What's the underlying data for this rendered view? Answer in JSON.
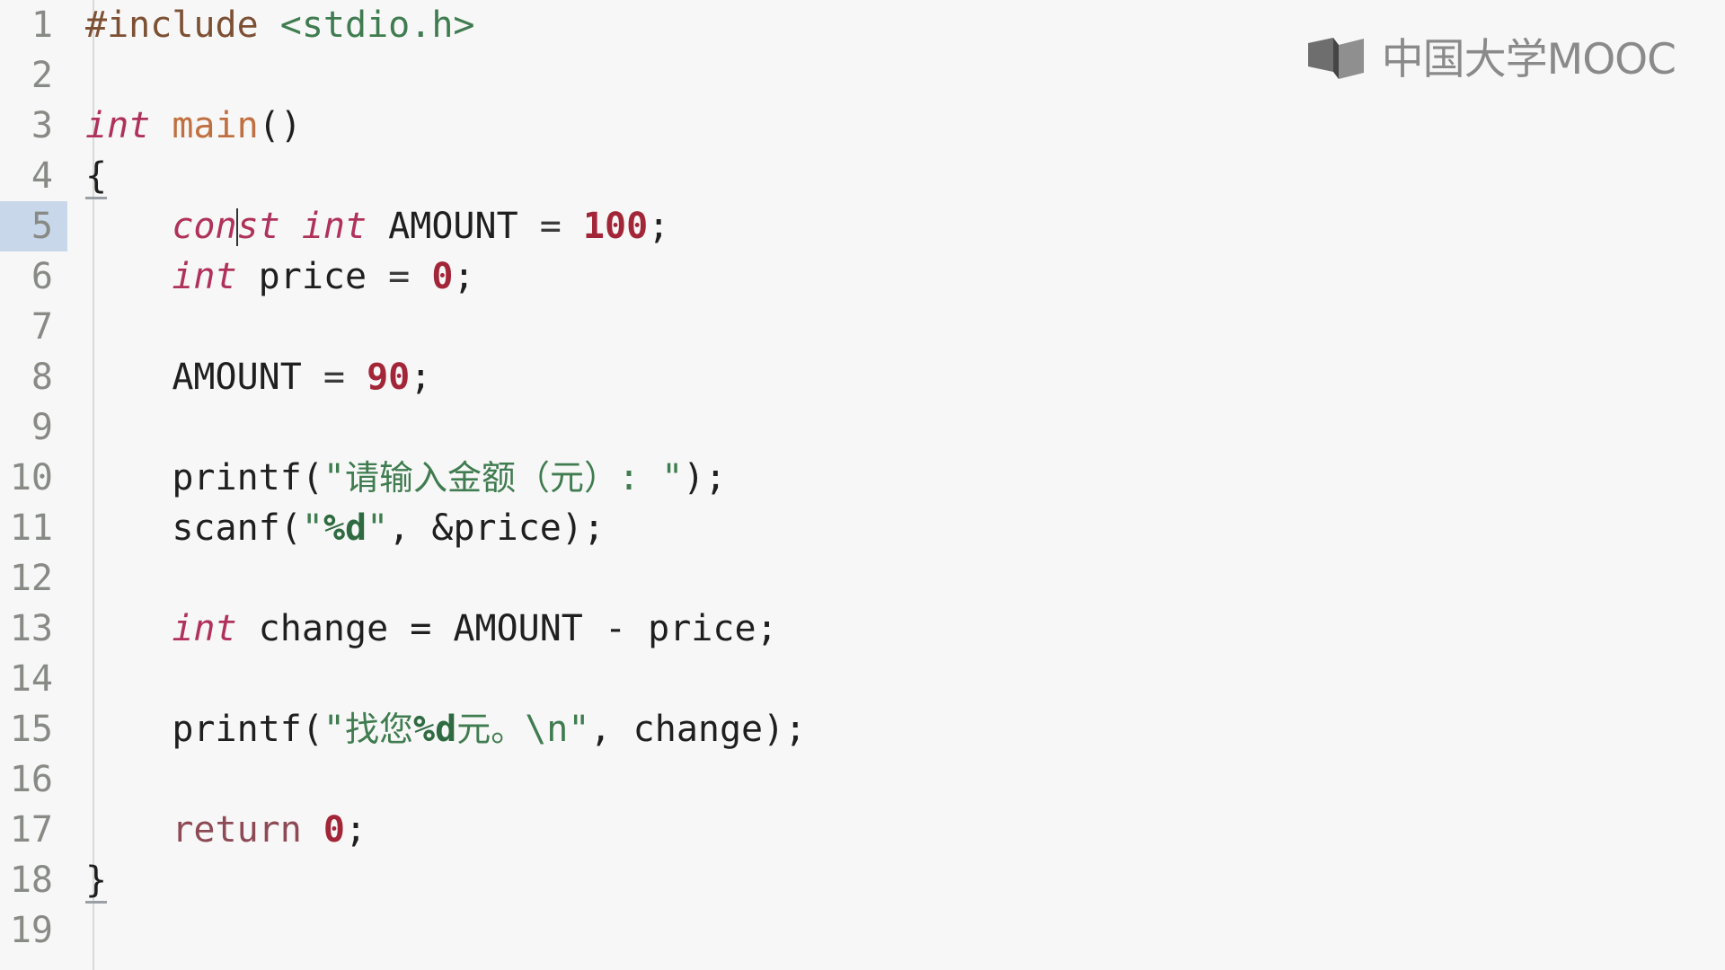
{
  "editor": {
    "language": "c",
    "active_line": 5,
    "cursor": {
      "line": 5,
      "column": 8
    },
    "gutter_first": "1",
    "gutter_last": "19",
    "colors": {
      "background": "#f7f7f7",
      "gutter_text": "#888a85",
      "active_line_gutter": "#c8d8ea",
      "keyword": "#b0315a",
      "string": "#3f7c4f",
      "number": "#a32638",
      "preprocessor": "#7d5033",
      "function": "#c07040",
      "plain": "#1f1f1f"
    },
    "lines": [
      {
        "n": "1",
        "text": "#include <stdio.h>"
      },
      {
        "n": "2",
        "text": ""
      },
      {
        "n": "3",
        "text": "int main()"
      },
      {
        "n": "4",
        "text": "{"
      },
      {
        "n": "5",
        "text": "    const int AMOUNT = 100;"
      },
      {
        "n": "6",
        "text": "    int price = 0;"
      },
      {
        "n": "7",
        "text": ""
      },
      {
        "n": "8",
        "text": "    AMOUNT = 90;"
      },
      {
        "n": "9",
        "text": ""
      },
      {
        "n": "10",
        "text": "    printf(\"请输入金额（元）: \");"
      },
      {
        "n": "11",
        "text": "    scanf(\"%d\", &price);"
      },
      {
        "n": "12",
        "text": ""
      },
      {
        "n": "13",
        "text": "    int change = AMOUNT - price;"
      },
      {
        "n": "14",
        "text": ""
      },
      {
        "n": "15",
        "text": "    printf(\"找您%d元。\\n\", change);"
      },
      {
        "n": "16",
        "text": ""
      },
      {
        "n": "17",
        "text": "    return 0;"
      },
      {
        "n": "18",
        "text": "}"
      },
      {
        "n": "19",
        "text": ""
      }
    ],
    "tokens": {
      "l1_include": "#include",
      "l1_header": "<stdio.h>",
      "l3_int": "int",
      "l3_main": "main",
      "l3_parens": "()",
      "l4_brace": "{",
      "l5_indent": "    ",
      "l5_con": "con",
      "l5_st": "st",
      "l5_space1": " ",
      "l5_int": "int",
      "l5_amount": " AMOUNT ",
      "l5_eq": "=",
      "l5_num": " 100",
      "l5_semi": ";",
      "l6_int": "int",
      "l6_price": " price ",
      "l6_eq": "=",
      "l6_num": " 0",
      "l6_semi": ";",
      "l8_amount": "AMOUNT ",
      "l8_eq": "=",
      "l8_num": " 90",
      "l8_semi": ";",
      "l10_printf": "printf",
      "l10_open": "(",
      "l10_quote1": "\"",
      "l10_cjk": "请输入金额（元）",
      "l10_colon": ": ",
      "l10_quote2": "\"",
      "l10_close": ");",
      "l11_scanf": "scanf",
      "l11_open": "(",
      "l11_quote1": "\"",
      "l11_fmt": "%d",
      "l11_quote2": "\"",
      "l11_args": ", &price);",
      "l13_int": "int",
      "l13_rest": " change = AMOUNT - price;",
      "l15_printf": "printf",
      "l15_open": "(",
      "l15_quote1": "\"",
      "l15_cjk1": "找您",
      "l15_fmt": "%d",
      "l15_cjk2": "元。",
      "l15_esc": "\\n",
      "l15_quote2": "\"",
      "l15_args": ", change);",
      "l17_return": "return",
      "l17_num": " 0",
      "l17_semi": ";",
      "l18_brace": "}"
    }
  },
  "watermark": {
    "logo_text": "中国大学MOOC",
    "icon": "open-book-mark",
    "color": "#8a8a8a"
  }
}
